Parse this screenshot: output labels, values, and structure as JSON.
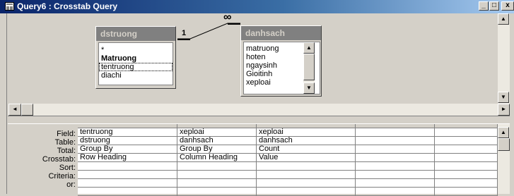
{
  "window": {
    "title": "Query6 : Crosstab Query"
  },
  "controls": {
    "minimize": "_",
    "maximize": "□",
    "close": "x"
  },
  "tables": [
    {
      "name": "dstruong",
      "fields": [
        "*",
        "Matruong",
        "tentruong",
        "diachi"
      ],
      "key_field": "Matruong",
      "focused_field": "tentruong"
    },
    {
      "name": "danhsach",
      "fields": [
        "matruong",
        "hoten",
        "ngaysinh",
        "Gioitinh",
        "xeploai"
      ]
    }
  ],
  "relationship": {
    "one_side": "1",
    "many_side": "∞"
  },
  "grid": {
    "row_labels": [
      "Field:",
      "Table:",
      "Total:",
      "Crosstab:",
      "Sort:",
      "Criteria:",
      "or:"
    ],
    "columns": [
      {
        "field": "tentruong",
        "table": "dstruong",
        "total": "Group By",
        "crosstab": "Row Heading",
        "sort": "",
        "criteria": "",
        "or": ""
      },
      {
        "field": "xeploai",
        "table": "danhsach",
        "total": "Group By",
        "crosstab": "Column Heading",
        "sort": "",
        "criteria": "",
        "or": ""
      },
      {
        "field": "xeploai",
        "table": "danhsach",
        "total": "Count",
        "crosstab": "Value",
        "sort": "",
        "criteria": "",
        "or": ""
      },
      {
        "field": "",
        "table": "",
        "total": "",
        "crosstab": "",
        "sort": "",
        "criteria": "",
        "or": ""
      },
      {
        "field": "",
        "table": "",
        "total": "",
        "crosstab": "",
        "sort": "",
        "criteria": "",
        "or": ""
      }
    ]
  },
  "colors": {
    "title_gradient_start": "#0a246a",
    "title_gradient_end": "#a6caf0",
    "face": "#d4d0c8",
    "fieldlist_title": "#808080"
  },
  "icons": {
    "window": "query-window-icon",
    "scroll_up": "arrow-up-icon",
    "scroll_down": "arrow-down-icon",
    "scroll_left": "arrow-left-icon",
    "scroll_right": "arrow-right-icon"
  }
}
